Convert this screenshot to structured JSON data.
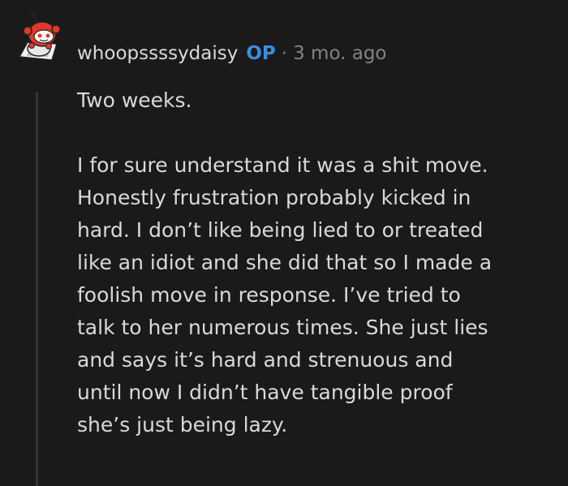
{
  "comment": {
    "author": "whoopssssydaisy",
    "badge": "OP",
    "separator": "·",
    "time": "3 mo. ago",
    "paragraph1": "Two weeks.",
    "paragraph2_lines": [
      "I for sure understand it was a shit move.",
      "Honestly frustration probably kicked in",
      "hard. I don’t like being lied to or treated",
      "like an idiot and she did that so I made a",
      "foolish move in response. I’ve tried to",
      "talk to her numerous times. She just lies",
      "and says it’s hard and strenuous and",
      "until now I didn’t have tangible proof",
      "she’s just being lazy."
    ]
  },
  "colors": {
    "background": "#1a1a1b",
    "text": "#d7dadc",
    "meta": "#818384",
    "op_badge": "#3b8dde",
    "thread_line": "#343536"
  },
  "icons": {
    "avatar": "snoo-avatar-icon"
  }
}
